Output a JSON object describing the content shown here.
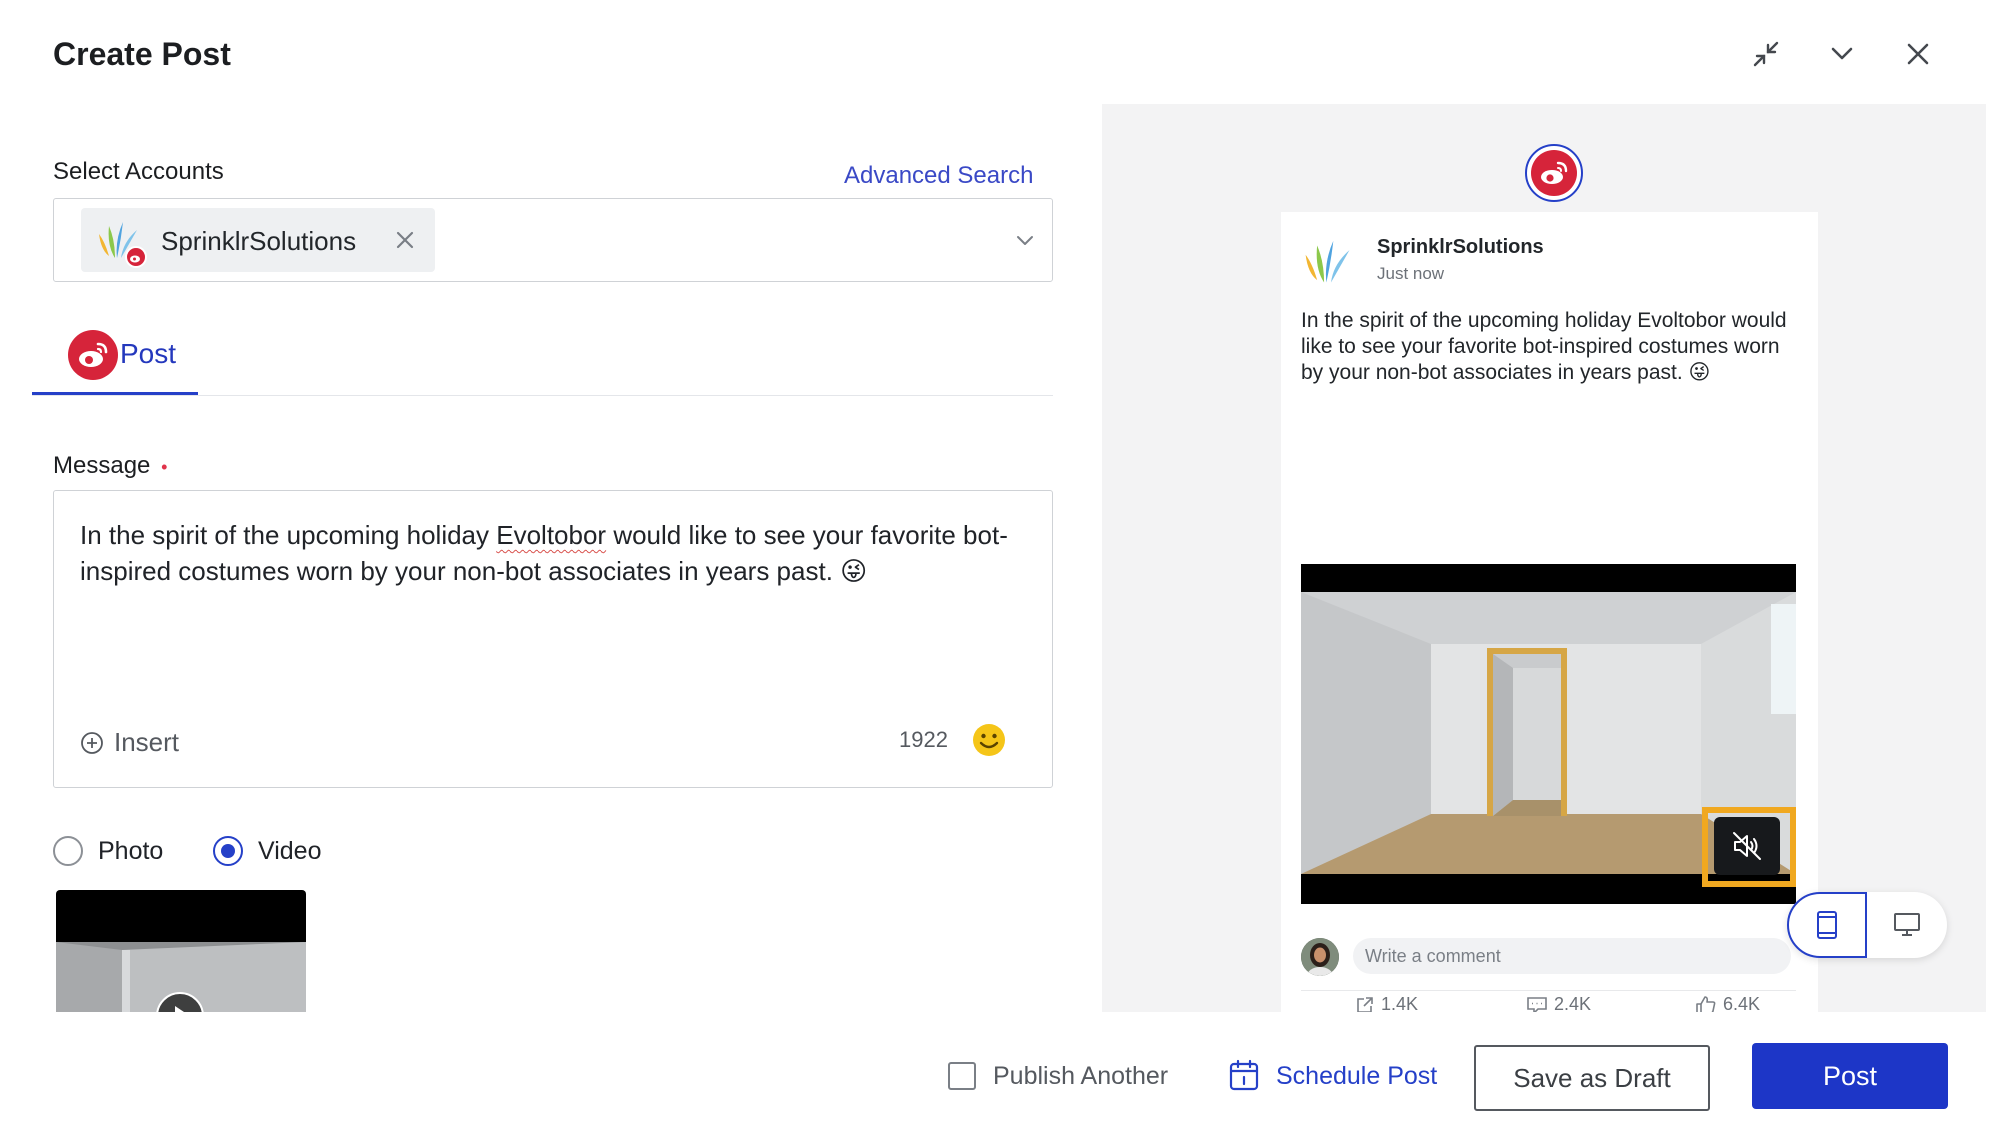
{
  "header": {
    "title": "Create Post",
    "icons": [
      "minimize-icon",
      "chevron-down-icon",
      "close-icon"
    ]
  },
  "accounts": {
    "label": "Select Accounts",
    "advanced_search": "Advanced Search",
    "selected": "SprinklrSolutions"
  },
  "tab": {
    "label": "Post",
    "icon": "weibo-icon"
  },
  "message": {
    "label": "Message",
    "required_marker": "•",
    "text_before": "In the spirit of the upcoming holiday ",
    "misspelled": "Evoltobor",
    "text_after": " would like to see your favorite bot-inspired costumes worn by your non-bot associates in years past. 😜",
    "insert_label": "Insert",
    "char_count": "1922"
  },
  "media": {
    "options": [
      {
        "label": "Photo",
        "selected": false
      },
      {
        "label": "Video",
        "selected": true
      }
    ]
  },
  "preview": {
    "account_name": "SprinklrSolutions",
    "time": "Just now",
    "text": "In the spirit of the upcoming holiday Evoltobor would like to see your favorite bot-inspired costumes worn by your non-bot associates in years past. 😜",
    "comment_placeholder": "Write a comment",
    "shares": "1.4K",
    "comments": "2.4K",
    "likes": "6.4K"
  },
  "footer": {
    "publish_another": "Publish Another",
    "schedule_post": "Schedule Post",
    "save_draft": "Save as Draft",
    "post": "Post"
  },
  "colors": {
    "accent": "#1d36c7",
    "weibo_red": "#d6243a",
    "highlight": "#f0a820"
  }
}
